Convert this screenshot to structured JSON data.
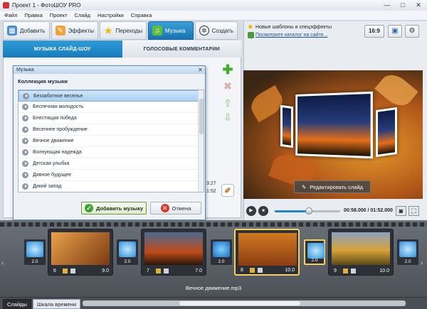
{
  "window": {
    "title": "Проект 1 - ФотоШОУ PRO",
    "controls": [
      "—",
      "□",
      "✕"
    ]
  },
  "menu": [
    "Файл",
    "Правка",
    "Проект",
    "Слайд",
    "Настройки",
    "Справка"
  ],
  "tabs": [
    {
      "label": "Добавить",
      "icon": "add-photos-icon",
      "active": false
    },
    {
      "label": "Эффекты",
      "icon": "effects-brush-icon",
      "active": false
    },
    {
      "label": "Переходы",
      "icon": "star-icon",
      "active": false
    },
    {
      "label": "Музыка",
      "icon": "music-note-icon",
      "active": true
    },
    {
      "label": "Создать",
      "icon": "film-reel-icon",
      "active": false
    }
  ],
  "subtabs": {
    "music": "МУЗЫКА СЛАЙД-ШОУ",
    "voice": "ГОЛОСОВЫЕ КОММЕНТАРИИ"
  },
  "background_times": [
    "3:27",
    "1:52"
  ],
  "dialog": {
    "title": "Музыка",
    "heading": "Коллекция музыки",
    "items": [
      "Беззаботное веселье",
      "Беспечная молодость",
      "Блестящая победа",
      "Весеннее пробуждение",
      "Вечное движение",
      "Волнующая надежда",
      "Детская улыбка",
      "Дивное будущее",
      "Дикий запад"
    ],
    "selected_index": 0,
    "add_label": "Добавить музыку",
    "cancel_label": "Отмена"
  },
  "promo": {
    "title": "Новые шаблоны и спецэффекты",
    "link": "Посмотрите каталог на сайте..."
  },
  "aspect_label": "16:9",
  "preview": {
    "edit_label": "Редактировать слайд"
  },
  "player": {
    "time": "00:58.000 / 01:52.000",
    "progress": 0.52
  },
  "timeline": {
    "slides": [
      {
        "num": "6",
        "duration": "9.0"
      },
      {
        "num": "7",
        "duration": "7.0"
      },
      {
        "num": "8",
        "duration": "10.0"
      },
      {
        "num": "9",
        "duration": "10.0"
      }
    ],
    "transitions": [
      "2.0",
      "2.0",
      "2.0",
      "2.0",
      "2.0"
    ],
    "audio_track": "Вечное движение.mp3"
  },
  "bottom_tabs": {
    "slides": "Слайды",
    "timeline": "Шкала времени"
  },
  "colors": {
    "accent": "#1e86c8",
    "selection": "#f4d25a",
    "add": "#3fa238",
    "cancel": "#d63a2c"
  }
}
